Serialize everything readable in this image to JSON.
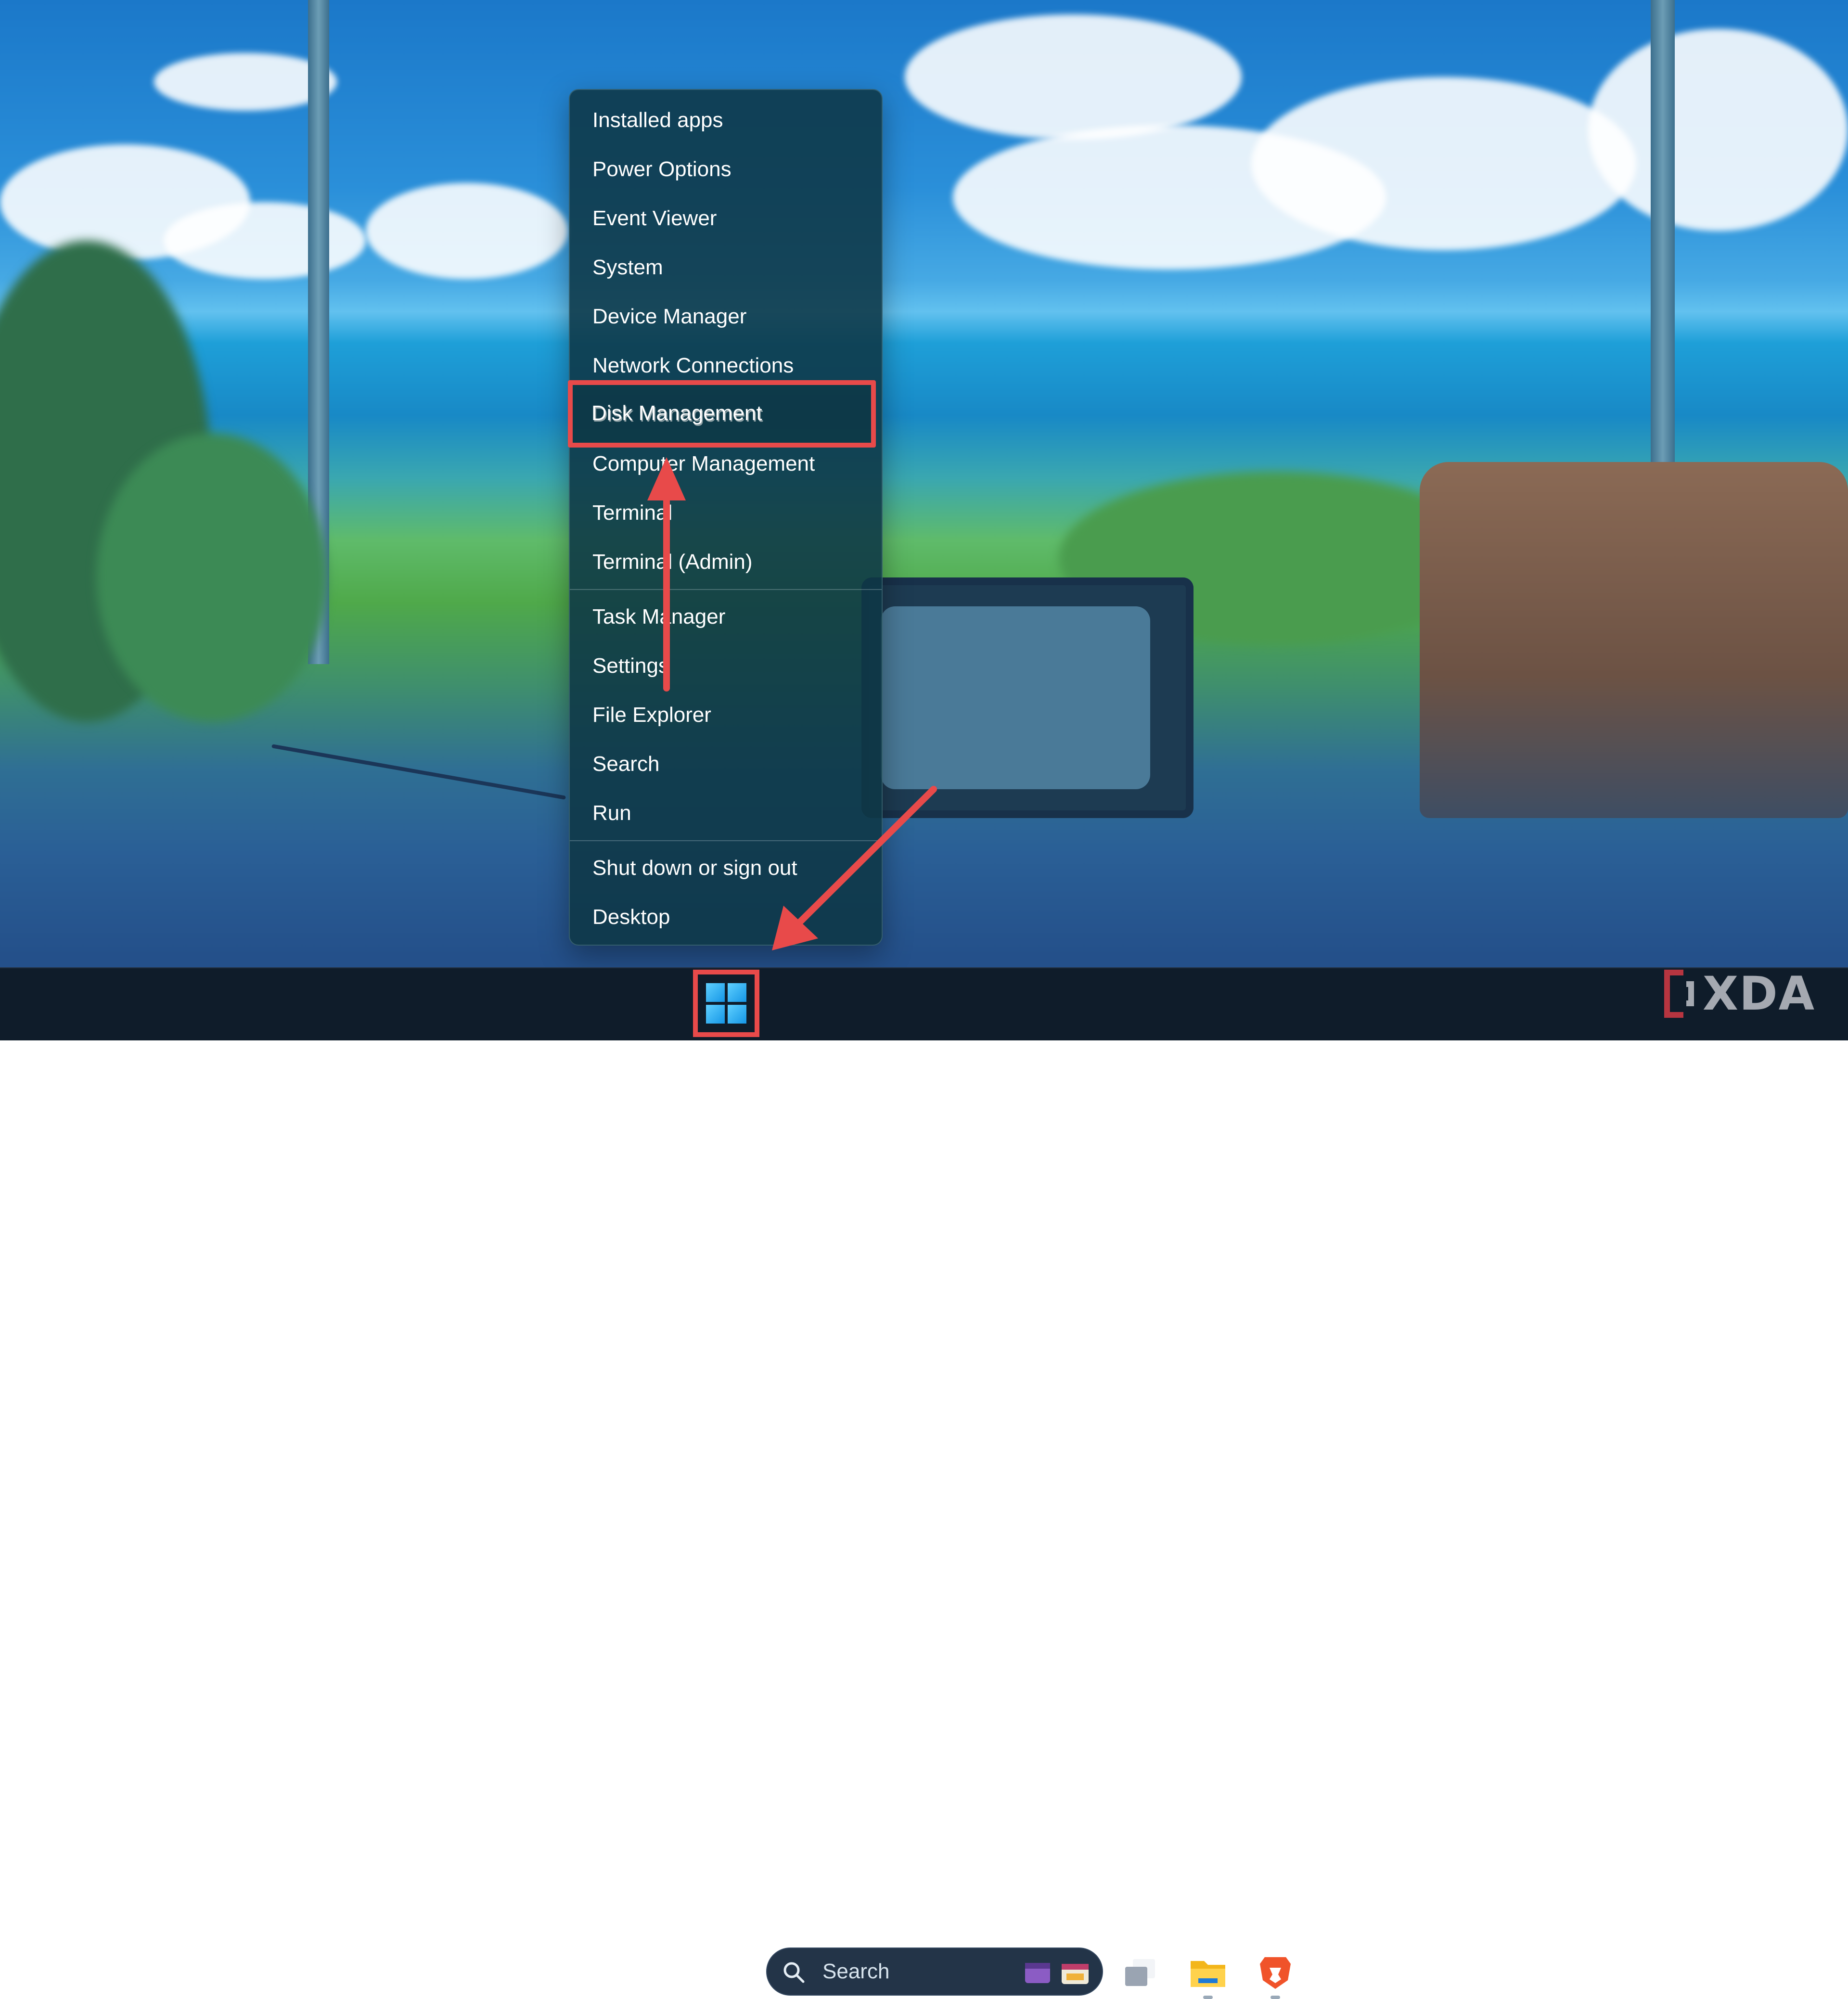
{
  "menu": {
    "items": [
      {
        "label": "Installed apps"
      },
      {
        "label": "Power Options"
      },
      {
        "label": "Event Viewer"
      },
      {
        "label": "System"
      },
      {
        "label": "Device Manager"
      },
      {
        "label": "Network Connections"
      },
      {
        "label": "Disk Management",
        "highlighted": true
      },
      {
        "label": "Computer Management"
      },
      {
        "label": "Terminal"
      },
      {
        "label": "Terminal (Admin)"
      },
      {
        "label": "Task Manager"
      },
      {
        "label": "Settings"
      },
      {
        "label": "File Explorer"
      },
      {
        "label": "Search"
      },
      {
        "label": "Run"
      },
      {
        "label": "Shut down or sign out",
        "submenu": true
      },
      {
        "label": "Desktop"
      }
    ]
  },
  "taskbar": {
    "search_label": "Search",
    "icons": [
      "start-windows-icon",
      "search-icon",
      "task-view-icon",
      "file-explorer-icon",
      "brave-browser-icon"
    ]
  },
  "watermark": {
    "text": "XDA"
  },
  "annotations": {
    "highlight_color": "#e84a4a"
  }
}
